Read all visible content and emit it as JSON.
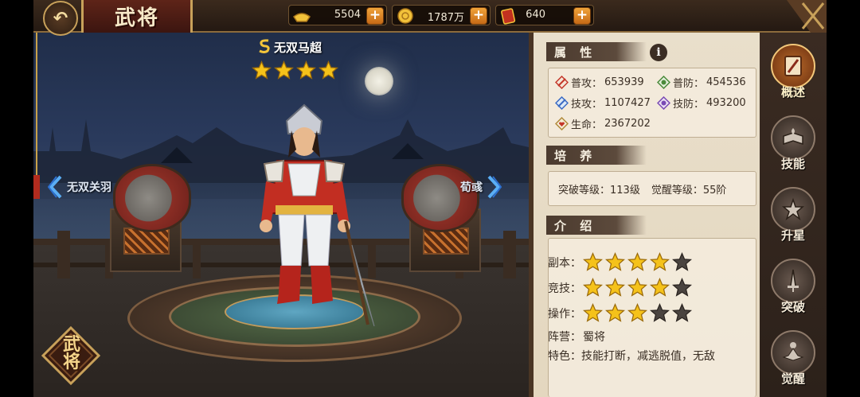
{
  "header": {
    "title": "武将",
    "back_label": "↶",
    "resources": [
      {
        "icon": "gold-ingot-icon",
        "value": "5504"
      },
      {
        "icon": "coin-icon",
        "value": "1787万"
      },
      {
        "icon": "scroll-ticket-icon",
        "value": "640"
      }
    ],
    "plus_label": "+"
  },
  "hero": {
    "name": "无双马超",
    "stars": 4,
    "prev_hero": "无双关羽",
    "next_hero": "荀彧"
  },
  "badge": {
    "text": "武将"
  },
  "attributes": {
    "heading": "属 性",
    "info": "i",
    "stats": [
      {
        "label": "普攻：",
        "value": "653939",
        "icon": "normal-attack-icon"
      },
      {
        "label": "普防：",
        "value": "454536",
        "icon": "normal-defense-icon"
      },
      {
        "label": "技攻：",
        "value": "1107427",
        "icon": "skill-attack-icon"
      },
      {
        "label": "技防：",
        "value": "493200",
        "icon": "skill-defense-icon"
      },
      {
        "label": "生命：",
        "value": "2367202",
        "icon": "health-icon"
      }
    ]
  },
  "training": {
    "heading": "培 养",
    "breakthrough_label": "突破等级：",
    "breakthrough_value": "113级",
    "awaken_label": "觉醒等级：",
    "awaken_value": "55阶"
  },
  "intro": {
    "heading": "介 绍",
    "ratings": [
      {
        "label": "副本：",
        "value": 4,
        "max": 5
      },
      {
        "label": "竞技：",
        "value": 4,
        "max": 5
      },
      {
        "label": "操作：",
        "value": 3,
        "max": 5
      }
    ],
    "faction_label": "阵营：",
    "faction_value": "蜀将",
    "feature_label": "特色：",
    "feature_value": "技能打断，减逃脱值，无敌"
  },
  "tabs": [
    {
      "label": "概述",
      "icon": "overview-scroll-icon",
      "active": true
    },
    {
      "label": "技能",
      "icon": "skill-book-icon",
      "active": false
    },
    {
      "label": "升星",
      "icon": "star-up-icon",
      "active": false
    },
    {
      "label": "突破",
      "icon": "breakthrough-sword-icon",
      "active": false
    },
    {
      "label": "觉醒",
      "icon": "awaken-meditate-icon",
      "active": false
    }
  ],
  "colors": {
    "star_gold": "#f5c21a",
    "star_empty": "#4a4440",
    "parchment": "#e9dfcb",
    "accent_orange": "#e58a25"
  }
}
